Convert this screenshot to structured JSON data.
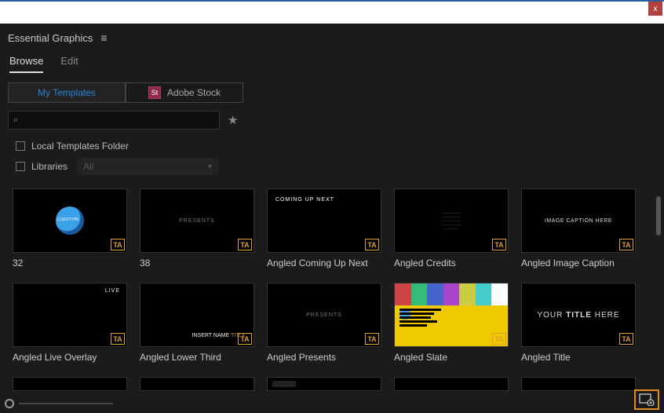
{
  "window": {
    "close_label": "x"
  },
  "panel": {
    "title": "Essential Graphics",
    "menu_glyph": "≡"
  },
  "tabs": {
    "browse": "Browse",
    "edit": "Edit"
  },
  "sources": {
    "my_templates": "My Templates",
    "stock_badge": "St",
    "adobe_stock": "Adobe Stock"
  },
  "search": {
    "placeholder": ""
  },
  "filters": {
    "local_folder": "Local Templates Folder",
    "libraries": "Libraries",
    "lib_selected": "All"
  },
  "items": [
    {
      "label": "32"
    },
    {
      "label": "38"
    },
    {
      "label": "Angled Coming Up Next"
    },
    {
      "label": "Angled Credits"
    },
    {
      "label": "Angled Image Caption"
    },
    {
      "label": "Angled Live Overlay"
    },
    {
      "label": "Angled Lower Third"
    },
    {
      "label": "Angled Presents"
    },
    {
      "label": "Angled Slate"
    },
    {
      "label": "Angled Title"
    }
  ],
  "thumb_text": {
    "presents": "PRESENTS",
    "coming": "COMING UP NEXT",
    "caption": "IMAGE CAPTION HERE",
    "live": "LIVE",
    "lower_pre": "INSERT NAME ",
    "lower_suf": "TITLE",
    "title_pre": "YOUR ",
    "title_mid": "TITLE",
    "title_suf": " HERE",
    "badge": "TA"
  }
}
